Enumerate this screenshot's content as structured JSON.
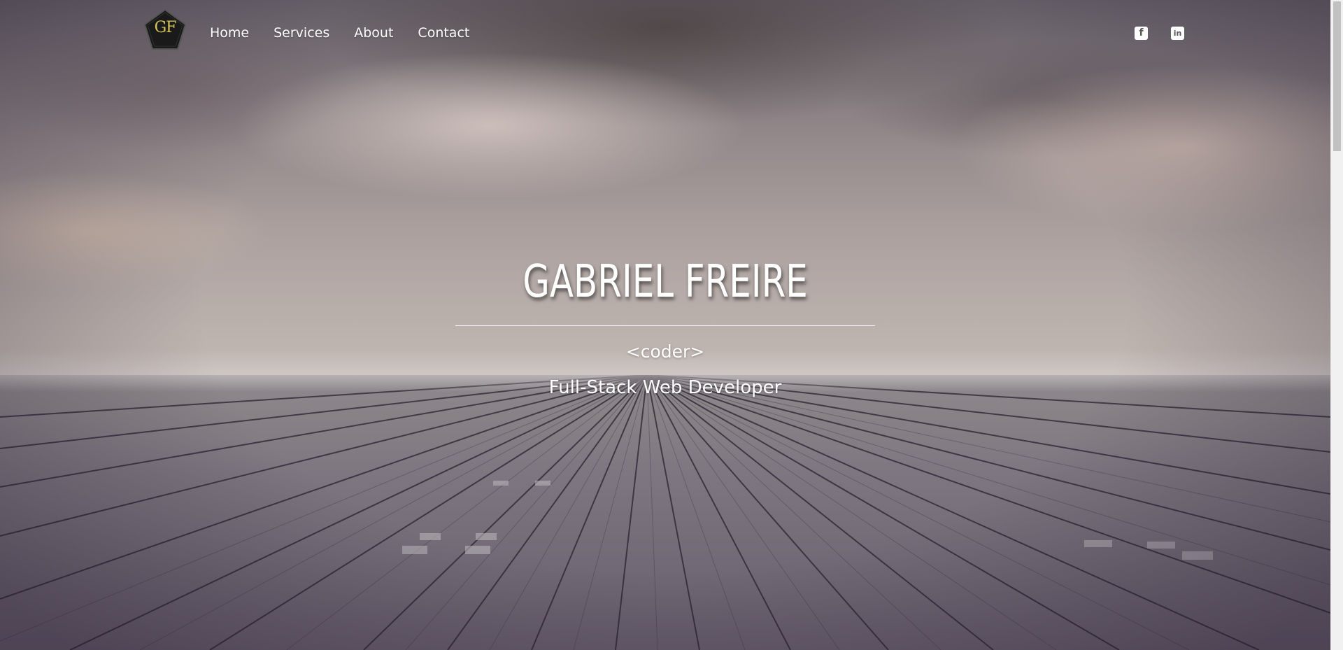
{
  "brand": {
    "logo_text": "GF"
  },
  "nav": {
    "items": [
      {
        "label": "Home"
      },
      {
        "label": "Services"
      },
      {
        "label": "About"
      },
      {
        "label": "Contact"
      }
    ]
  },
  "social": {
    "facebook_icon": "f",
    "linkedin_icon": "in"
  },
  "hero": {
    "title": "GABRIEL FREIRE",
    "tag": "<coder>",
    "subtitle": "Full-Stack Web Developer"
  },
  "colors": {
    "logo_accent": "#d6c65a",
    "text": "#ffffff",
    "icon_bg": "#ffffff"
  },
  "icons": {
    "logo": "pentagon-logo-icon",
    "facebook": "facebook-icon",
    "linkedin": "linkedin-icon"
  }
}
